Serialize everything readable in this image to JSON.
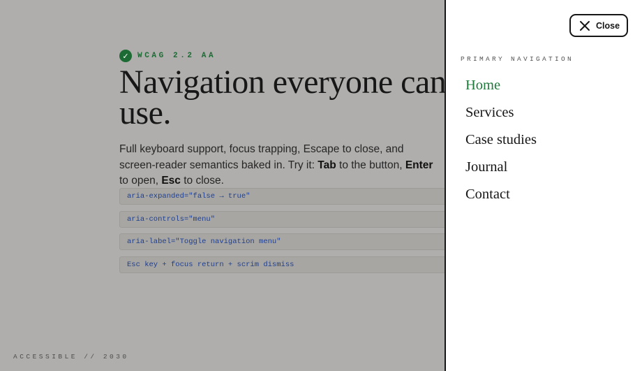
{
  "page": {
    "badge": {
      "icon": "check-icon",
      "text": "WCAG 2.2 AA"
    },
    "headline": "Navigation everyone can actually use.",
    "lede": {
      "intro": "Full keyboard support, focus trapping, Escape to close, and screen-reader semantics baked in. Try it: ",
      "key_tab": "Tab",
      "after_tab": " to the button, ",
      "key_enter": "Enter",
      "after_enter": " to open, ",
      "key_esc": "Esc",
      "after_esc": " to close."
    },
    "chips": [
      "aria-expanded=\"false → true\"",
      "aria-controls=\"menu\"",
      "aria-label=\"Toggle navigation menu\"",
      "Esc key + focus return + scrim dismiss"
    ],
    "footer": "ACCESSIBLE // 2030"
  },
  "drawer": {
    "close": {
      "icon": "close-icon",
      "label": "Close"
    },
    "heading": "PRIMARY NAVIGATION",
    "items": [
      {
        "label": "Home",
        "active": true
      },
      {
        "label": "Services",
        "active": false
      },
      {
        "label": "Case studies",
        "active": false
      },
      {
        "label": "Journal",
        "active": false
      },
      {
        "label": "Contact",
        "active": false
      }
    ]
  },
  "colors": {
    "scrim": "#afaeac",
    "accent_green": "#1d7a3a",
    "code_blue": "#1f3f8f",
    "ink": "#161616"
  }
}
